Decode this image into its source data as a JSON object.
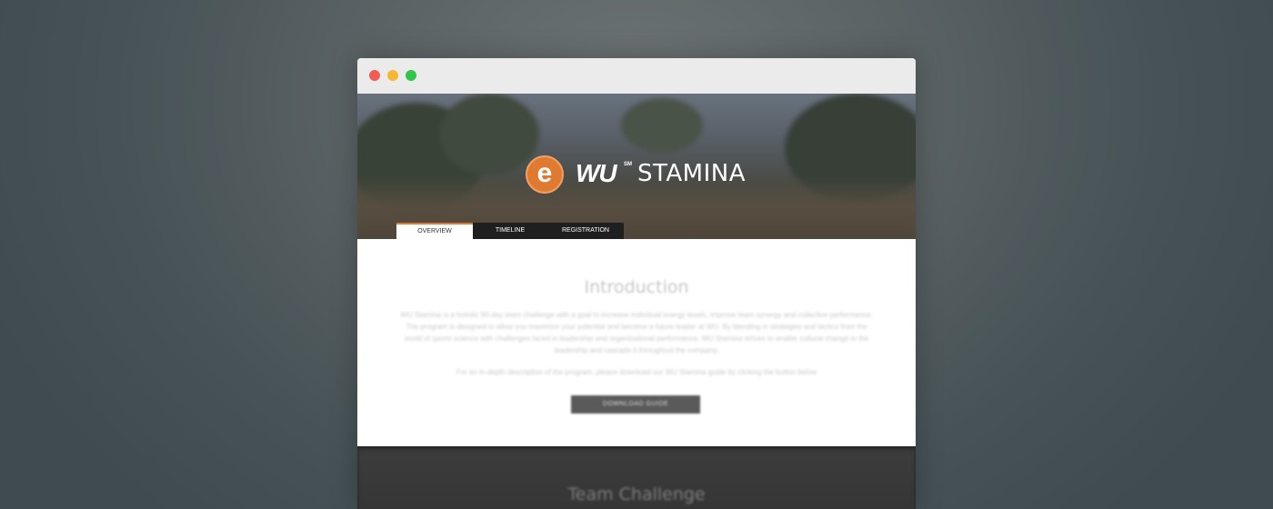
{
  "window": {
    "controls": [
      "close",
      "minimize",
      "maximize"
    ],
    "colors": {
      "close": "#f25c54",
      "minimize": "#f7b731",
      "maximize": "#2fc64a"
    }
  },
  "header": {
    "logo_letter": "e",
    "brand_wu": "WU",
    "brand_superscript": "SM",
    "brand_name": "STAMINA",
    "accent_color": "#e07a31"
  },
  "tabs": [
    {
      "label": "OVERVIEW",
      "active": true
    },
    {
      "label": "TIMELINE",
      "active": false
    },
    {
      "label": "REGISTRATION",
      "active": false
    }
  ],
  "intro": {
    "title": "Introduction",
    "body": "WU Stamina is a holistic 90-day team challenge with a goal to increase individual energy levels, improve team synergy and collective performance. The program is designed to allow you maximize your potential and become a future leader at WU. By blending in strategies and tactics from the world of sports science with challenges faced in leadership and organizational performance, WU Stamina strives to enable cultural change in the leadership and cascade it throughout the company.",
    "cta_text": "For an in-depth description of the program, please download our WU Stamina guide by clicking the button below",
    "button_label": "DOWNLOAD GUIDE"
  },
  "team_section": {
    "title": "Team Challenge"
  }
}
